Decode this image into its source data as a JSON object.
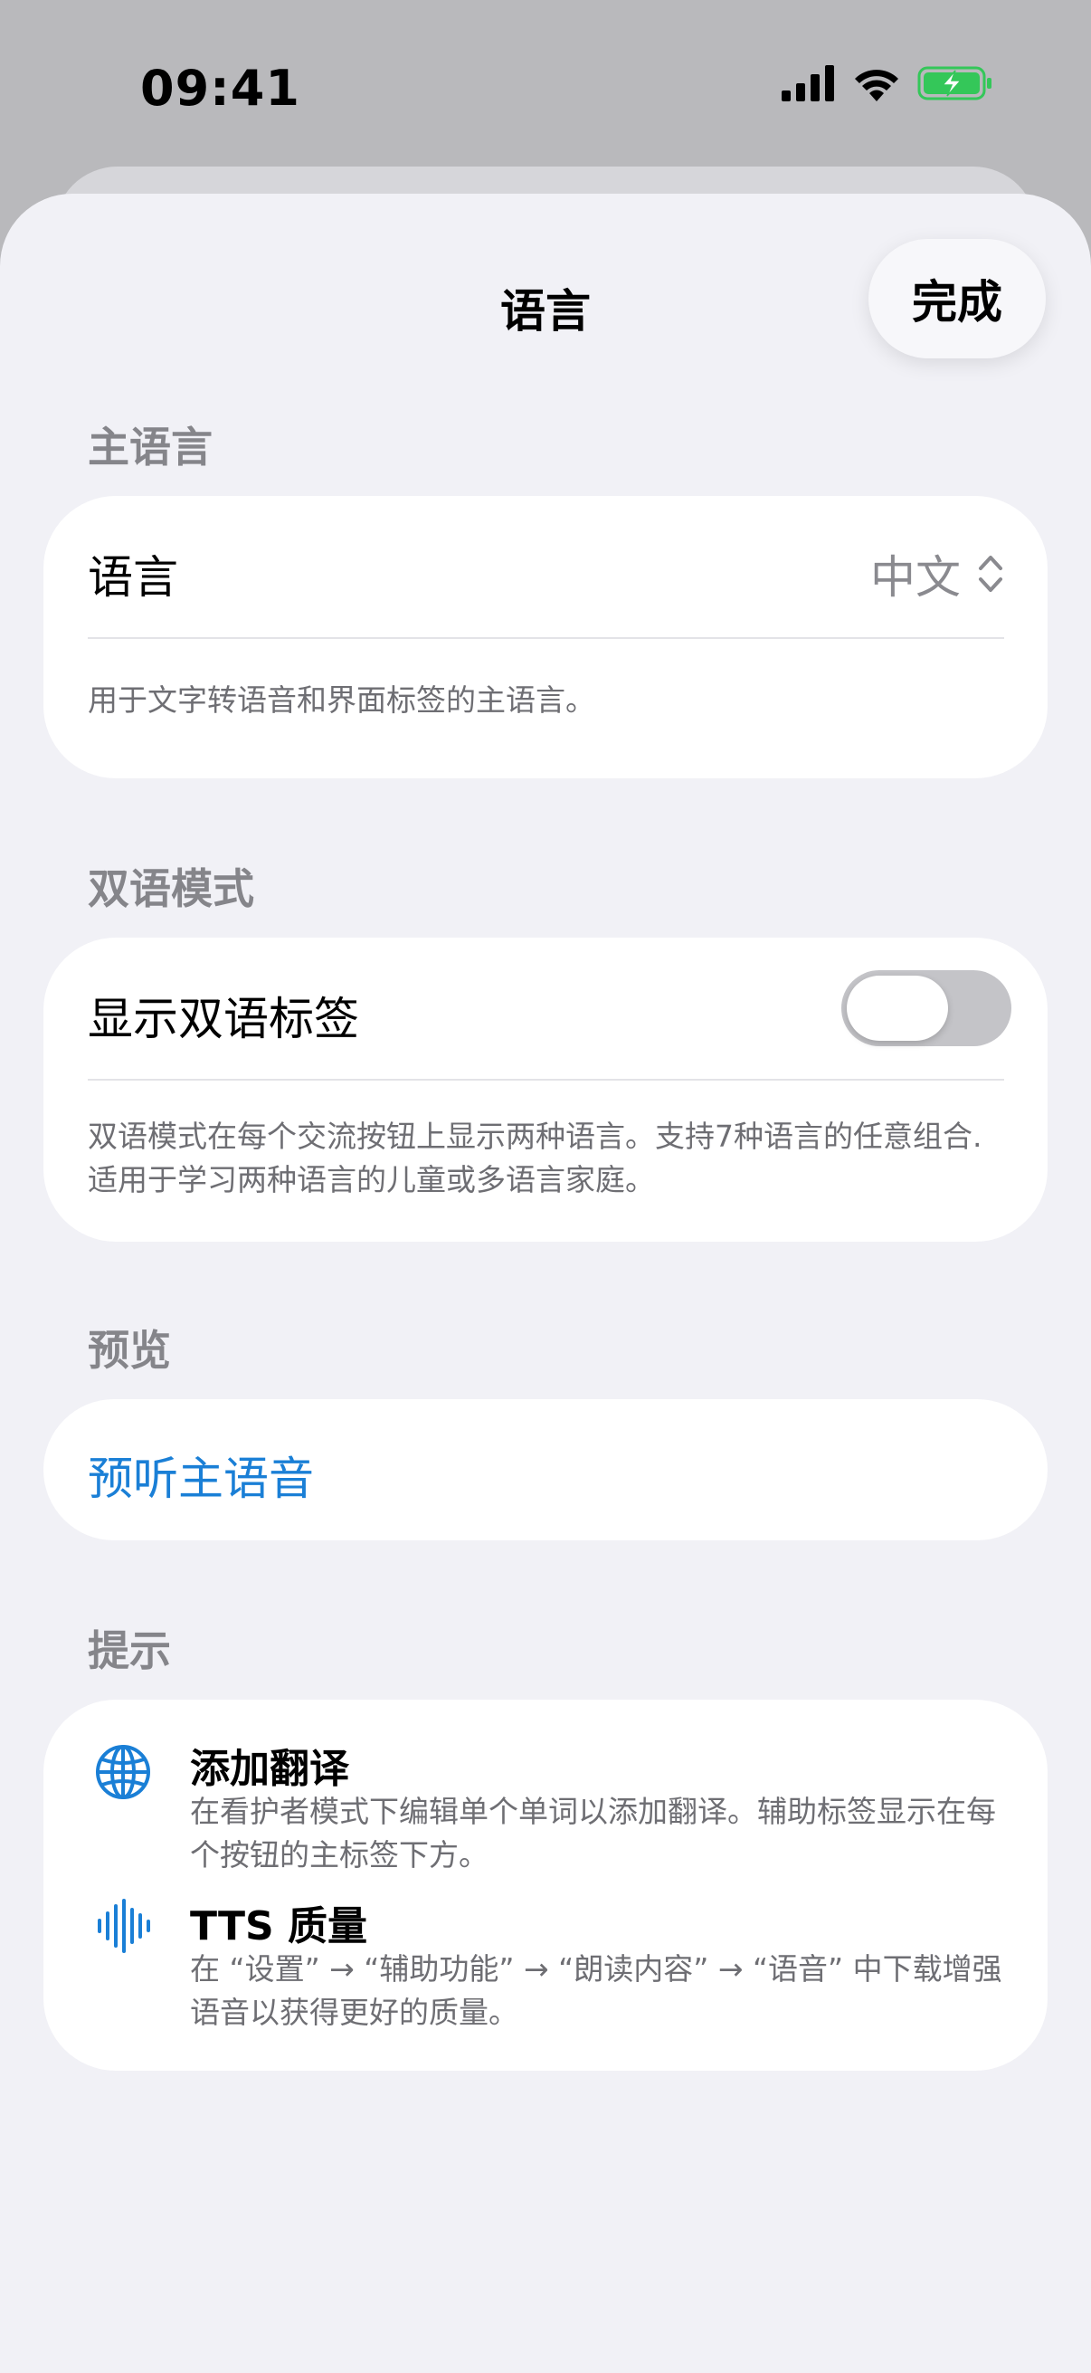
{
  "status_bar": {
    "time": "09:41"
  },
  "sheet": {
    "title": "语言",
    "done_label": "完成"
  },
  "primary_language": {
    "header": "主语言",
    "row_label": "语言",
    "selected_value": "中文",
    "footnote": "用于文字转语音和界面标签的主语言。"
  },
  "bilingual": {
    "header": "双语模式",
    "row_label": "显示双语标签",
    "toggle_on": false,
    "footnote": "双语模式在每个交流按钮上显示两种语言。支持7种语言的任意组合. 适用于学习两种语言的儿童或多语言家庭。"
  },
  "preview": {
    "header": "预览",
    "link_label": "预听主语音"
  },
  "tips": {
    "header": "提示",
    "items": [
      {
        "icon": "globe-icon",
        "title": "添加翻译",
        "description": "在看护者模式下编辑单个单词以添加翻译。辅助标签显示在每个按钮的主标签下方。"
      },
      {
        "icon": "waveform-icon",
        "title": "TTS 质量",
        "description": "在 “设置” → “辅助功能” → “朗读内容” → “语音” 中下载增强语音以获得更好的质量。"
      }
    ]
  },
  "colors": {
    "accent": "#1a7fd6",
    "battery": "#34c759",
    "sheet_background": "#f1f1f6",
    "card_background": "#ffffff"
  }
}
